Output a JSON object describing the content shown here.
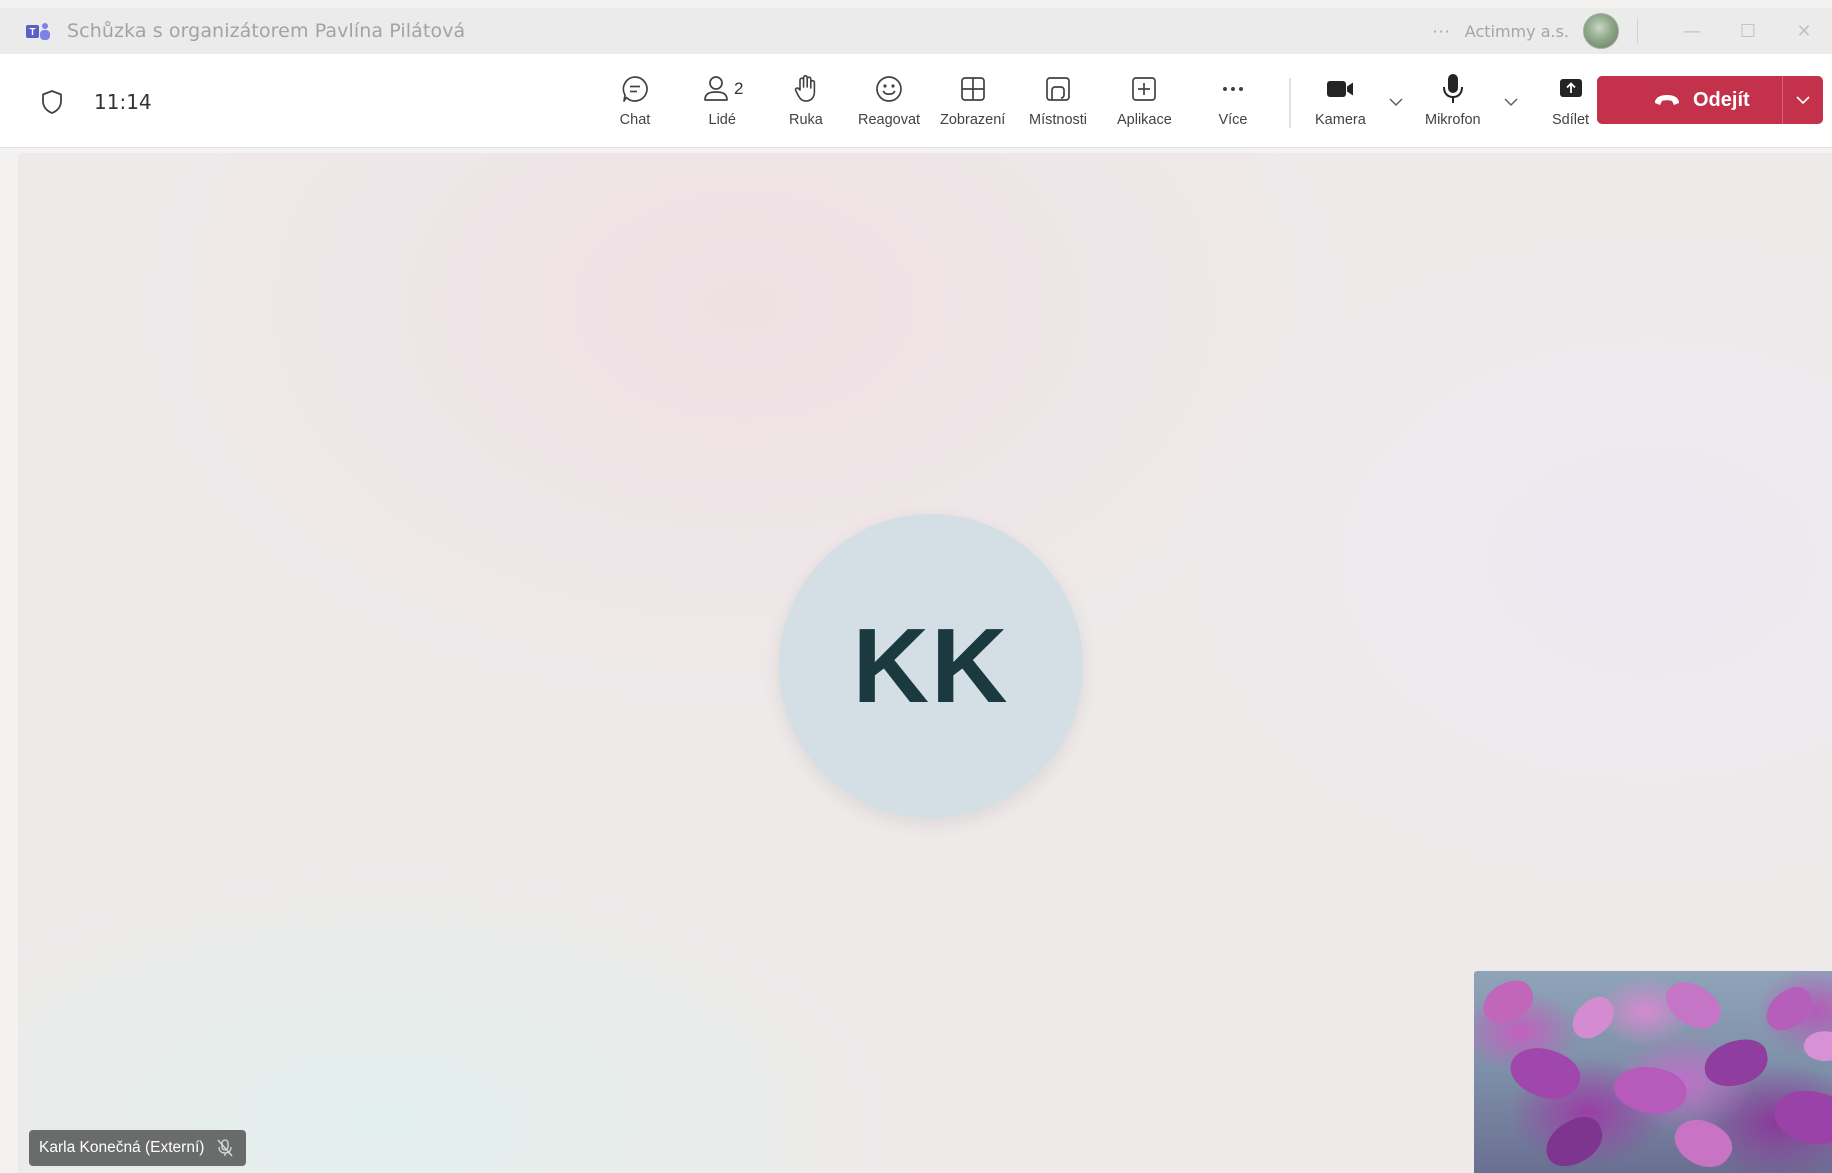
{
  "window": {
    "title": "Schůzka s organizátorem Pavlína Pilátová",
    "more_label": "···",
    "organization": "Actimmy a.s.",
    "minimize": "—",
    "maximize": "☐",
    "close": "✕"
  },
  "toolbar": {
    "time": "11:14",
    "people_count": "2",
    "buttons": {
      "chat": "Chat",
      "people": "Lidé",
      "hand": "Ruka",
      "react": "Reagovat",
      "view": "Zobrazení",
      "rooms": "Místnosti",
      "apps": "Aplikace",
      "more": "Více",
      "camera": "Kamera",
      "mic": "Mikrofon",
      "share": "Sdílet"
    },
    "leave_label": "Odejít"
  },
  "stage": {
    "participant_initials": "KK",
    "participant_name": "Karla Konečná (Externí)"
  },
  "colors": {
    "leave_button": "#c4314b",
    "teams_brand": "#5b5fc7",
    "avatar_bg": "#d3dfe4",
    "avatar_text": "#1b3a40"
  }
}
